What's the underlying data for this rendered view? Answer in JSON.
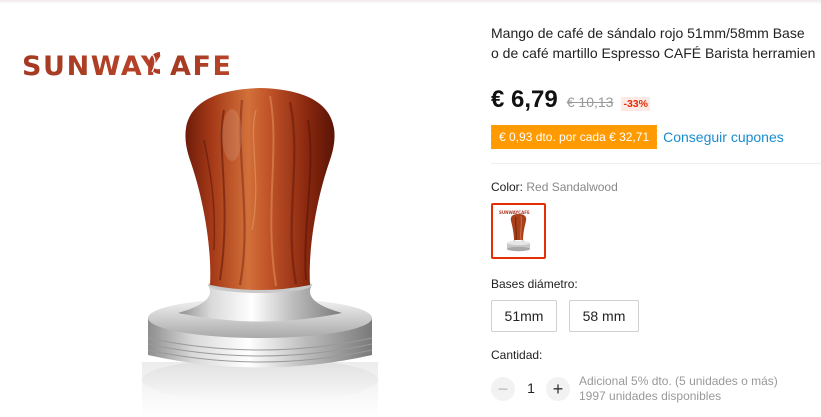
{
  "brand": {
    "logo": "SUNWAYCAFE"
  },
  "product": {
    "title_line1": "Mango de café de sándalo rojo 51mm/58mm Base",
    "title_line2": "o de café martillo Espresso CAFÉ Barista herramien",
    "price": "€ 6,79",
    "original_price": "€ 10,13",
    "discount": "-33%"
  },
  "coupon": {
    "badge": "€ 0,93 dto. por cada € 32,71",
    "link": "Conseguir cupones"
  },
  "color": {
    "label": "Color:",
    "value": "Red Sandalwood",
    "swatch_icon": "tamper-thumbnail",
    "selected_border": "#e62e04"
  },
  "size": {
    "label": "Bases diámetro:",
    "options": [
      "51mm",
      "58 mm"
    ]
  },
  "quantity": {
    "label": "Cantidad:",
    "value": "1",
    "minus": "−",
    "plus": "+",
    "note_line1": "Adicional 5% dto. (5 unidades o más)",
    "note_line2": "1997 unidades disponibles"
  },
  "colors": {
    "price_accent": "#e62e04",
    "coupon_bg": "#ff9a00",
    "link": "#1a8ccf",
    "wood": "#b5451f"
  }
}
